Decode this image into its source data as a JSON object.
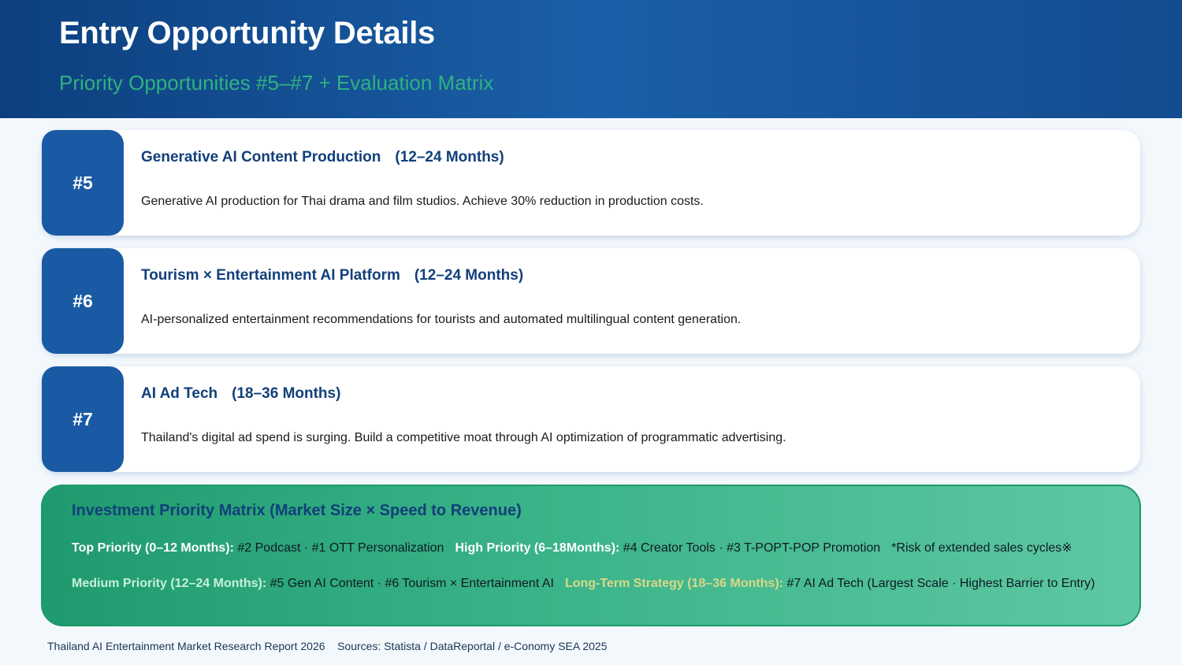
{
  "header": {
    "title": "Entry Opportunity Details",
    "subtitle": "Priority Opportunities #5–#7 + Evaluation Matrix"
  },
  "opportunities": [
    {
      "number": "#5",
      "title": "Generative AI Content Production",
      "duration": "(12–24 Months)",
      "description": "Generative AI production for Thai drama and film studios. Achieve 30% reduction in production costs."
    },
    {
      "number": "#6",
      "title": "Tourism × Entertainment AI Platform",
      "duration": "(12–24 Months)",
      "description": "AI-personalized entertainment recommendations for tourists and automated multilingual content generation."
    },
    {
      "number": "#7",
      "title": "AI Ad Tech",
      "duration": "(18–36 Months)",
      "description": "Thailand's digital ad spend is surging. Build a competitive moat through AI optimization of programmatic advertising."
    }
  ],
  "matrix": {
    "title": "Investment Priority Matrix (Market Size × Speed to Revenue)",
    "top_priority_label": "Top Priority (0–12 Months):",
    "top_priority_items": " #2 Podcast · #1 OTT Personalization",
    "high_priority_label": "High Priority (6–18Months):",
    "high_priority_items": " #4 Creator Tools · #3 T-POPT-POP Promotion",
    "note": "*Risk of extended sales cycles※",
    "medium_priority_label": "Medium Priority (12–24 Months):",
    "medium_priority_items": " #5 Gen AI Content · #6 Tourism × Entertainment AI",
    "long_term_label": "Long-Term Strategy  (18–36 Months):",
    "long_term_items": " #7 AI Ad Tech (Largest Scale · Highest Barrier to Entry)"
  },
  "footer": {
    "text": "Thailand AI Entertainment Market Research Report 2026    Sources: Statista / DataReportal / e-Conomy SEA 2025"
  },
  "colors": {
    "header_dark": "#0d3f7e",
    "subtitle_green": "#2fb27f",
    "badge_blue": "#1a5aa4",
    "title_navy": "#123f7a",
    "matrix_green": "#1f9a6e"
  }
}
